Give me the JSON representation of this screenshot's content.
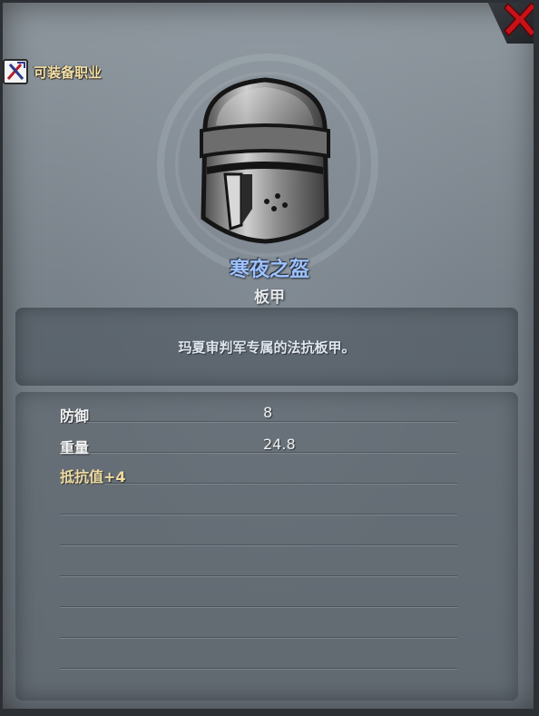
{
  "window": {
    "close_icon": "close-x-icon",
    "accent_red": "#c8121a"
  },
  "class_badge": {
    "icon": "crossed-tools-icon",
    "label": "可装备职业"
  },
  "item": {
    "icon": "great-helm-icon",
    "name": "寒夜之盔",
    "type": "板甲",
    "name_color": "#9ec2ff",
    "description": "玛夏审判军专属的法抗板甲。"
  },
  "stats": [
    {
      "label": "防御",
      "value": "8"
    },
    {
      "label": "重量",
      "value": "24.8"
    }
  ],
  "special_stat": {
    "label": "抵抗值",
    "value": "+4",
    "color": "#efdba0"
  }
}
